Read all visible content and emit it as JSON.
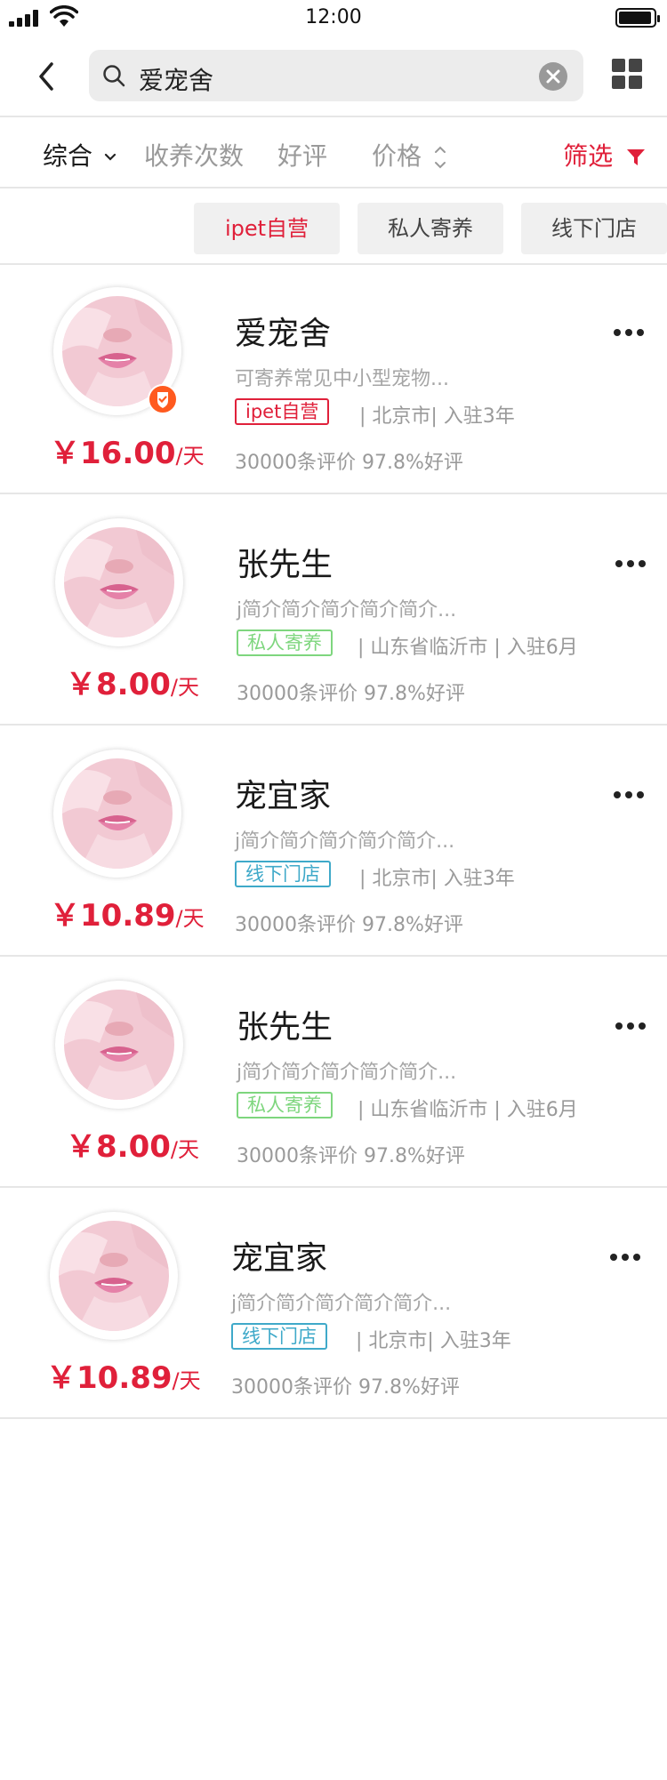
{
  "status_bar": {
    "time": "12:00"
  },
  "search": {
    "query": "爱宠舍"
  },
  "sort_bar": {
    "items": [
      {
        "label": "综合"
      },
      {
        "label": "收养次数"
      },
      {
        "label": "好评"
      },
      {
        "label": "价格"
      }
    ],
    "filter_label": "筛选"
  },
  "categories": [
    {
      "label": "ipet自营",
      "active": true
    },
    {
      "label": "私人寄养",
      "active": false
    },
    {
      "label": "线下门店",
      "active": false
    }
  ],
  "tag_colors": {
    "ipet自营": "#e0203a",
    "私人寄养": "#7ed67e",
    "线下门店": "#3fa9c9"
  },
  "accent_color": "#e0203a",
  "shops": [
    {
      "name": "爱宠舍",
      "price": "￥16.00",
      "unit": "/天",
      "description": "可寄养常见中小型宠物...",
      "tag": "ipet自营",
      "location": "| 北京市| 入驻3年",
      "reviews": "30000条评价 97.8%好评",
      "verified": true
    },
    {
      "name": "张先生",
      "price": "￥8.00",
      "unit": "/天",
      "description": "j简介简介简介简介简介...",
      "tag": "私人寄养",
      "location": "| 山东省临沂市 | 入驻6月",
      "reviews": "30000条评价 97.8%好评",
      "verified": false
    },
    {
      "name": "宠宜家",
      "price": "￥10.89",
      "unit": "/天",
      "description": "j简介简介简介简介简介...",
      "tag": "线下门店",
      "location": "| 北京市| 入驻3年",
      "reviews": "30000条评价 97.8%好评",
      "verified": false
    },
    {
      "name": "张先生",
      "price": "￥8.00",
      "unit": "/天",
      "description": "j简介简介简介简介简介...",
      "tag": "私人寄养",
      "location": "| 山东省临沂市 | 入驻6月",
      "reviews": "30000条评价 97.8%好评",
      "verified": false
    },
    {
      "name": "宠宜家",
      "price": "￥10.89",
      "unit": "/天",
      "description": "j简介简介简介简介简介...",
      "tag": "线下门店",
      "location": "| 北京市| 入驻3年",
      "reviews": "30000条评价 97.8%好评",
      "verified": false
    }
  ]
}
